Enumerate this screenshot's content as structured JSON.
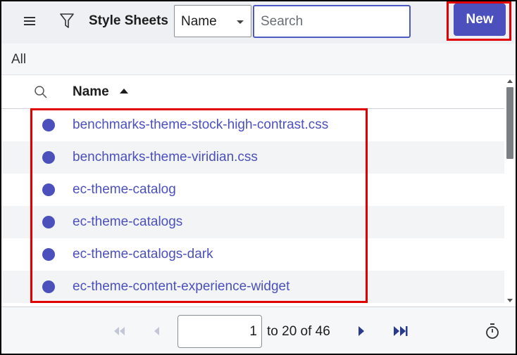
{
  "header": {
    "title": "Style Sheets",
    "field_select_value": "Name",
    "search_placeholder": "Search",
    "new_button_label": "New",
    "icons": [
      "menu-icon",
      "filter-icon"
    ]
  },
  "breadcrumb": {
    "label": "All"
  },
  "table": {
    "columns": [
      {
        "label": "Name",
        "sort": "ascending"
      }
    ],
    "rows": [
      {
        "name": "benchmarks-theme-stock-high-contrast.css"
      },
      {
        "name": "benchmarks-theme-viridian.css"
      },
      {
        "name": "ec-theme-catalog"
      },
      {
        "name": "ec-theme-catalogs"
      },
      {
        "name": "ec-theme-catalogs-dark"
      },
      {
        "name": "ec-theme-content-experience-widget"
      }
    ]
  },
  "pagination": {
    "current": "1",
    "range_text": "to 20 of 46"
  },
  "colors": {
    "accent": "#4b50bd",
    "highlight": "#e00000",
    "header_bg": "#eef0f3"
  }
}
